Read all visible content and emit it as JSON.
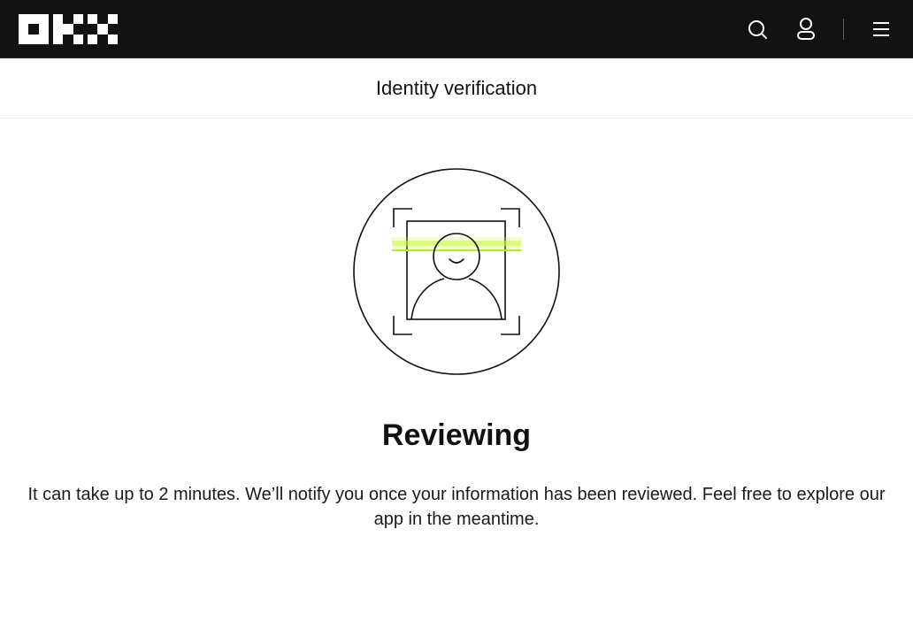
{
  "header": {
    "logo_text": "OKX",
    "icons": {
      "search": "search-icon",
      "user": "user-icon",
      "menu": "hamburger-menu-icon"
    }
  },
  "subheader": {
    "title": "Identity verification"
  },
  "status": {
    "illustration": "face-scan-icon",
    "accent_color": "#c8f541",
    "title": "Reviewing",
    "description": "It can take up to 2 minutes. We’ll notify you once your information has been reviewed. Feel free to explore our app in the meantime."
  }
}
